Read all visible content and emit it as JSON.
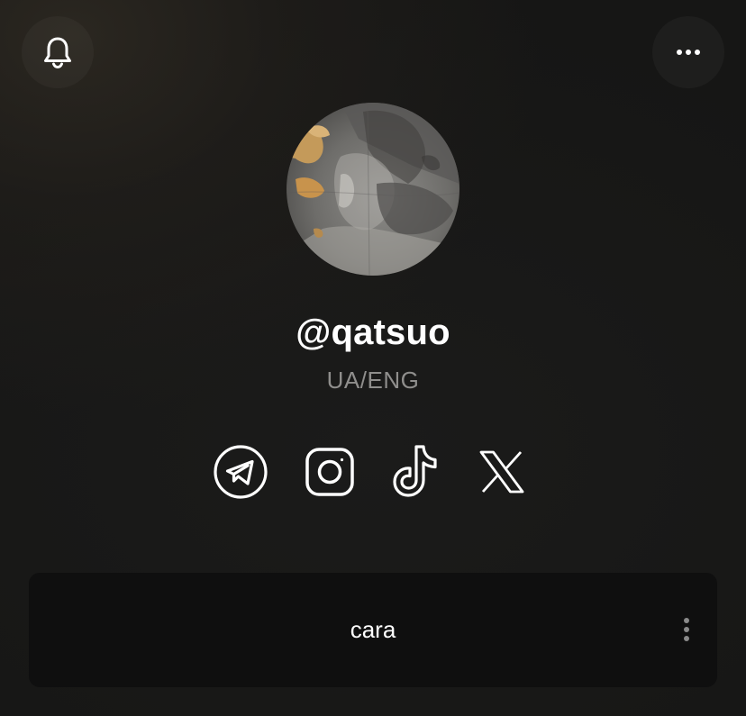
{
  "profile": {
    "username": "@qatsuo",
    "bio": "UA/ENG"
  },
  "header": {
    "notification_icon": "bell-icon",
    "menu_icon": "more-horizontal-icon"
  },
  "socials": [
    {
      "name": "Telegram",
      "icon": "telegram-icon"
    },
    {
      "name": "Instagram",
      "icon": "instagram-icon"
    },
    {
      "name": "TikTok",
      "icon": "tiktok-icon"
    },
    {
      "name": "X",
      "icon": "x-icon"
    }
  ],
  "links": [
    {
      "title": "cara",
      "menu_icon": "more-vertical-icon"
    }
  ],
  "colors": {
    "background": "#181716",
    "text": "#ffffff",
    "muted": "#8f8e8c",
    "card": "#0f0f0f",
    "avatar_gold": "#c49a5a"
  }
}
